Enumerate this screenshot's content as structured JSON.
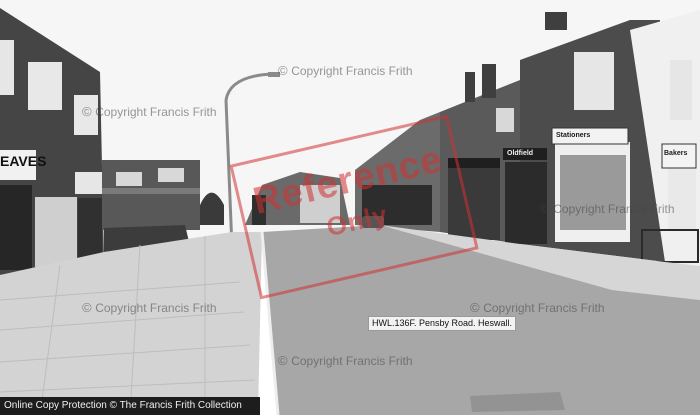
{
  "photo": {
    "watermark_text": "Copyright Francis Frith",
    "caption": "HWL.136F.     Pensby Road. Heswall.",
    "stamp_line1": "Reference",
    "stamp_line2": "Only",
    "footer": "Online Copy Protection © The Francis Frith Collection",
    "signs": {
      "left_shop": "EAVES",
      "right_shop_1": "Oldfield",
      "right_shop_2": "Stationers",
      "right_shop_3": "Bakers"
    }
  },
  "colors": {
    "sky": "#f7f7f7",
    "road": "#a9a9a9",
    "pavement": "#d3d3d3",
    "brick": "#4a4a4a",
    "stamp": "#d23232"
  }
}
